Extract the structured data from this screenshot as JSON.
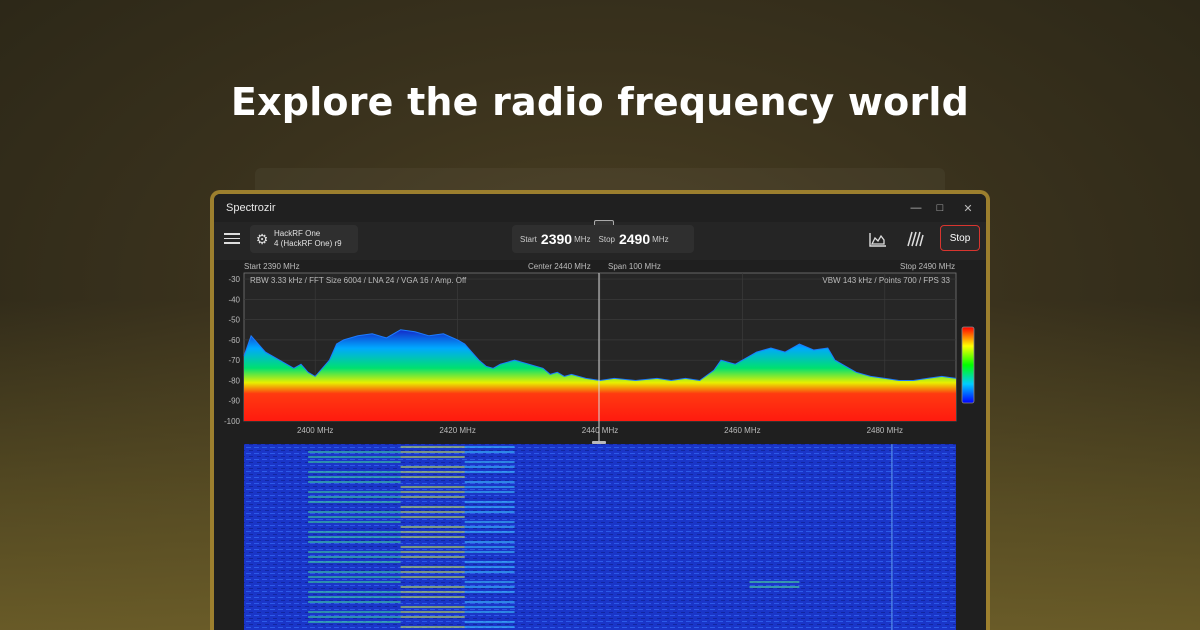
{
  "headline": "Explore the radio frequency world",
  "app": {
    "title": "Spectrozir",
    "window_controls": [
      "minimize-icon",
      "maximize-icon",
      "close-icon"
    ]
  },
  "toolbar": {
    "device_name": "HackRF One",
    "device_detail": "4 (HackRF One) r9",
    "start_label": "Start",
    "start_value": "2390",
    "start_unit": "MHz",
    "stop_label": "Stop",
    "stop_value": "2490",
    "stop_unit": "MHz",
    "stop_button": "Stop"
  },
  "spectrum_header": {
    "start": "Start 2390 MHz",
    "center": "Center 2440 MHz",
    "span": "Span 100 MHz",
    "stop": "Stop 2490 MHz",
    "info_left": "RBW 3.33 kHz / FFT Size 6004 / LNA 24 / VGA 16 / Amp. Off",
    "info_right": "VBW 143 kHz / Points 700 / FPS 33"
  },
  "colors": {
    "accent_frame": "#9c7f2e",
    "stop_border": "#d8352f",
    "trace_red": "#ff1a0f",
    "waterfall_bg": "#1a35c8"
  },
  "chart_data": {
    "type": "area",
    "y_ticks": [
      "-30",
      "-40",
      "-50",
      "-60",
      "-70",
      "-80",
      "-90",
      "-100"
    ],
    "x_ticks": [
      "2400 MHz",
      "2420 MHz",
      "2440 MHz",
      "2460 MHz",
      "2480 MHz"
    ],
    "x_range": [
      2390,
      2490
    ],
    "ylim": [
      -100,
      -27
    ],
    "grid": true,
    "series": [
      {
        "x": [
          2390,
          2391,
          2392,
          2393,
          2395,
          2397,
          2398,
          2399,
          2400,
          2401,
          2402,
          2403,
          2404,
          2406,
          2408,
          2410,
          2412,
          2414,
          2416,
          2418,
          2420,
          2421,
          2422,
          2423,
          2424,
          2425,
          2426,
          2428,
          2430,
          2432,
          2433,
          2434,
          2435,
          2436,
          2438,
          2440,
          2442,
          2445,
          2448,
          2450,
          2452,
          2454,
          2456,
          2457,
          2459,
          2460,
          2462,
          2464,
          2466,
          2468,
          2470,
          2472,
          2473,
          2475,
          2476,
          2478,
          2480,
          2482,
          2484,
          2486,
          2488,
          2490
        ],
        "values": [
          -68,
          -58,
          -62,
          -66,
          -70,
          -74,
          -72,
          -76,
          -78,
          -74,
          -70,
          -62,
          -60,
          -58,
          -57,
          -59,
          -55,
          -56,
          -58,
          -57,
          -60,
          -62,
          -66,
          -70,
          -73,
          -74,
          -72,
          -70,
          -72,
          -74,
          -77,
          -76,
          -78,
          -77,
          -79,
          -80,
          -79,
          -80,
          -79,
          -80,
          -79,
          -80,
          -75,
          -70,
          -72,
          -70,
          -66,
          -64,
          -66,
          -62,
          -65,
          -64,
          -70,
          -74,
          -76,
          -78,
          -79,
          -80,
          -80,
          -79,
          -78,
          -79
        ]
      }
    ],
    "colorbar": [
      "#ff0000",
      "#ffff00",
      "#00ff00",
      "#00ccff",
      "#0000ff"
    ]
  }
}
